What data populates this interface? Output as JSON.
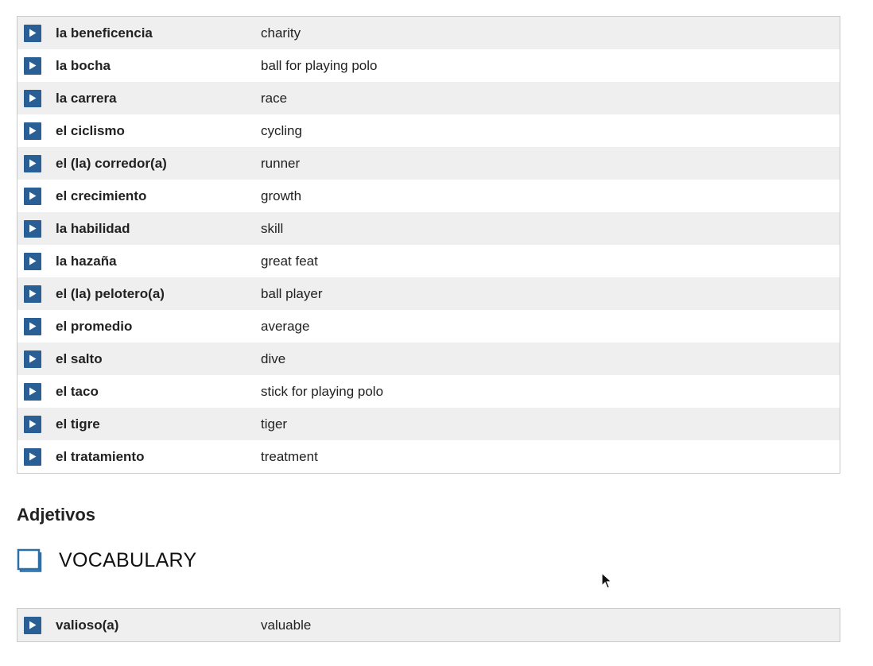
{
  "nouns": [
    {
      "word": "la beneficencia",
      "meaning": "charity"
    },
    {
      "word": "la bocha",
      "meaning": "ball for playing polo"
    },
    {
      "word": "la carrera",
      "meaning": "race"
    },
    {
      "word": "el ciclismo",
      "meaning": "cycling"
    },
    {
      "word": "el (la) corredor(a)",
      "meaning": "runner"
    },
    {
      "word": "el crecimiento",
      "meaning": "growth"
    },
    {
      "word": "la habilidad",
      "meaning": "skill"
    },
    {
      "word": "la hazaña",
      "meaning": "great feat"
    },
    {
      "word": "el (la) pelotero(a)",
      "meaning": "ball player"
    },
    {
      "word": "el promedio",
      "meaning": "average"
    },
    {
      "word": "el salto",
      "meaning": "dive"
    },
    {
      "word": "el taco",
      "meaning": "stick for playing polo"
    },
    {
      "word": "el tigre",
      "meaning": "tiger"
    },
    {
      "word": "el tratamiento",
      "meaning": "treatment"
    }
  ],
  "section_heading": "Adjetivos",
  "vocab_label": "VOCABULARY",
  "adjectives": [
    {
      "word": "valioso(a)",
      "meaning": "valuable"
    }
  ],
  "icons": {
    "play": "play-icon",
    "book": "book-icon",
    "cursor": "mouse-cursor-icon"
  },
  "colors": {
    "play_button": "#2a5f95",
    "row_alt": "#efefef",
    "book_icon": "#2a6fa8"
  }
}
